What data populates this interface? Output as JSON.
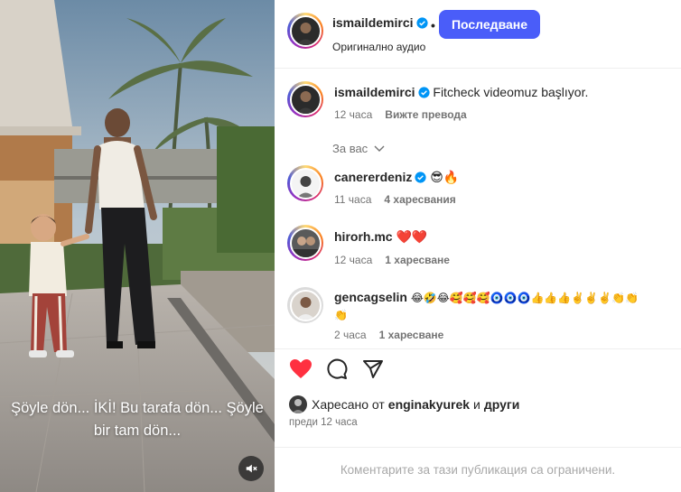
{
  "media": {
    "caption": "Şöyle dön... İKİ! Bu tarafa dön... Şöyle bir tam dön...",
    "mute_icon": "speaker-muted-icon"
  },
  "header": {
    "username": "ismaildemirci",
    "separator": "•",
    "follow_label": "Последване",
    "audio_label": "Оригинално аудио"
  },
  "post": {
    "username": "ismaildemirci",
    "text": "Fitcheck videomuz başlıyor.",
    "time": "12 часа",
    "translate_label": "Вижте превода"
  },
  "filter": {
    "label": "За вас"
  },
  "comments": [
    {
      "username": "canererdeniz",
      "verified": true,
      "text": "😎🔥",
      "time": "11 часа",
      "likes": "4 харесвания"
    },
    {
      "username": "hirorh.mc",
      "verified": false,
      "text": "❤️❤️",
      "time": "12 часа",
      "likes": "1 харесване"
    },
    {
      "username": "gencagselin",
      "verified": false,
      "text": "😂🤣😂🥰🥰🥰🧿🧿🧿👍👍👍✌️✌️✌️👏👏",
      "text2": "👏",
      "time": "2 часа",
      "likes": "1 харесване"
    }
  ],
  "actions": {
    "liked_by_prefix": "Харесано от",
    "liked_by_user": "enginakyurek",
    "liked_by_and": "и",
    "liked_by_others": "други",
    "time": "преди 12 часа",
    "restricted_notice": "Коментарите за тази публикация са ограничени."
  },
  "colors": {
    "accent": "#4a5df9",
    "verified": "#0095f6",
    "like": "#ff3040",
    "muted_text": "#737373"
  }
}
